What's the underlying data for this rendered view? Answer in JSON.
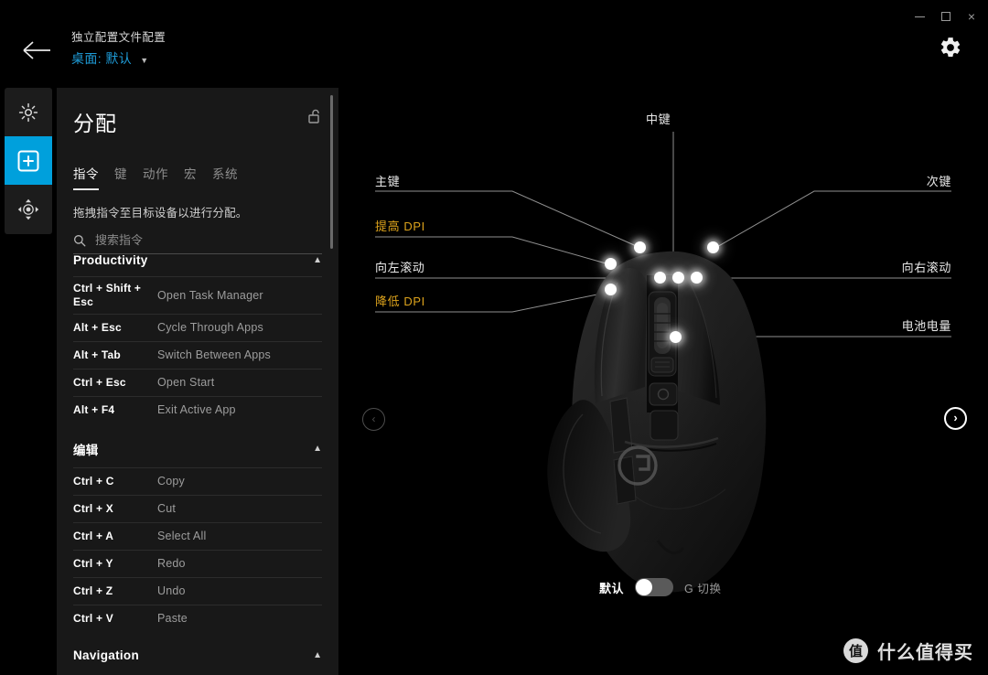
{
  "window": {
    "minimize_label": "–",
    "maximize_label": "□",
    "close_label": "×"
  },
  "header": {
    "back_icon": "arrow-left-icon",
    "title": "独立配置文件配置",
    "profile": "桌面: 默认",
    "chevron": "▼",
    "settings_icon": "gear-icon",
    "link_color": "#1e9bd7"
  },
  "sidebar": {
    "accent_color": "#00a0dc",
    "items": [
      {
        "icon": "lighting-sun-icon",
        "active": false
      },
      {
        "icon": "assignments-plus-icon",
        "active": true
      },
      {
        "icon": "sensitivity-move-icon",
        "active": false
      }
    ]
  },
  "panel": {
    "title": "分配",
    "lock_icon": "lock-open-icon",
    "tabs": [
      {
        "label": "指令",
        "active": true
      },
      {
        "label": "键",
        "active": false
      },
      {
        "label": "动作",
        "active": false
      },
      {
        "label": "宏",
        "active": false
      },
      {
        "label": "系统",
        "active": false
      }
    ],
    "description": "拖拽指令至目标设备以进行分配。",
    "search": {
      "icon": "search-icon",
      "placeholder": "搜索指令",
      "value": ""
    },
    "groups": [
      {
        "name": "Productivity",
        "chevron": "⌃",
        "commands": [
          {
            "keys": "Ctrl + Shift + Esc",
            "label": "Open Task Manager"
          },
          {
            "keys": "Alt + Esc",
            "label": "Cycle Through Apps"
          },
          {
            "keys": "Alt + Tab",
            "label": "Switch Between Apps"
          },
          {
            "keys": "Ctrl + Esc",
            "label": "Open Start"
          },
          {
            "keys": "Alt + F4",
            "label": "Exit Active App"
          }
        ]
      },
      {
        "name": "编辑",
        "chevron": "⌃",
        "commands": [
          {
            "keys": "Ctrl + C",
            "label": "Copy"
          },
          {
            "keys": "Ctrl + X",
            "label": "Cut"
          },
          {
            "keys": "Ctrl + A",
            "label": "Select All"
          },
          {
            "keys": "Ctrl + Y",
            "label": "Redo"
          },
          {
            "keys": "Ctrl + Z",
            "label": "Undo"
          },
          {
            "keys": "Ctrl + V",
            "label": "Paste"
          }
        ]
      },
      {
        "name": "Navigation",
        "chevron": "⌃",
        "commands": []
      }
    ]
  },
  "diagram": {
    "device": "logitech-g502-mouse",
    "gold_color": "#dda31c",
    "labels": {
      "middle": "中键",
      "primary": "主键",
      "secondary": "次键",
      "dpi_up": "提高 DPI",
      "scroll_left": "向左滚动",
      "scroll_right": "向右滚动",
      "dpi_down": "降低 DPI",
      "battery": "电池电量"
    },
    "nav": {
      "prev_icon": "chevron-left-icon",
      "prev_label": "‹",
      "next_icon": "chevron-right-icon",
      "next_label": "›"
    }
  },
  "toggle": {
    "left_label": "默认",
    "right_label": "G 切换",
    "state": "left"
  },
  "watermark": {
    "badge": "值",
    "text": "什么值得买"
  }
}
